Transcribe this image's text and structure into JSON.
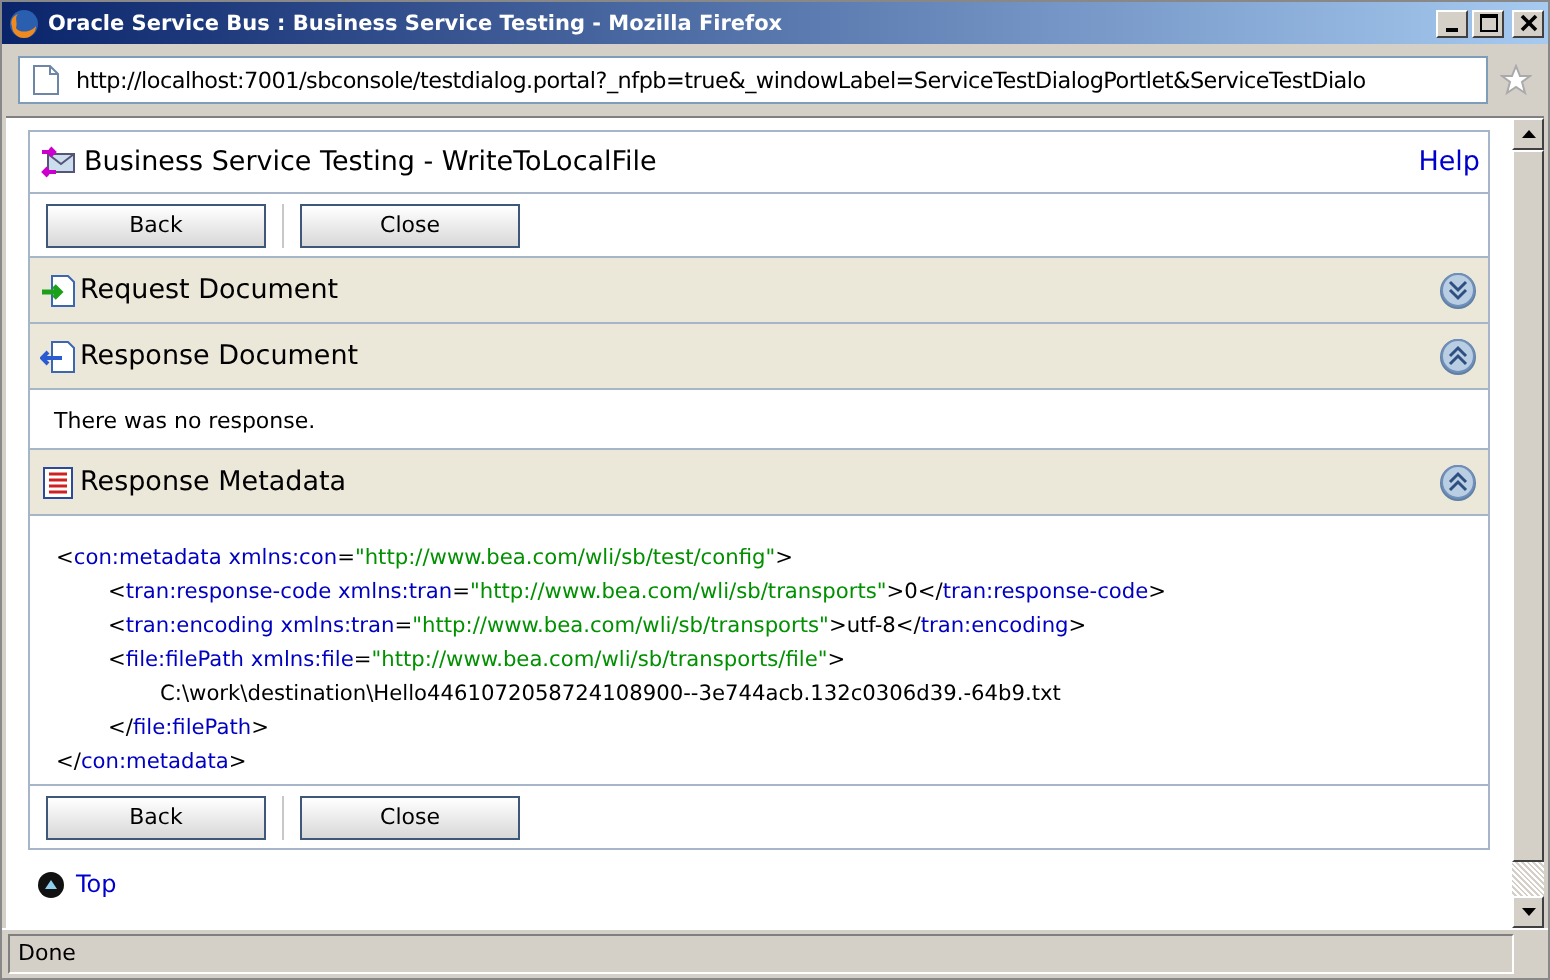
{
  "window": {
    "title": "Oracle Service Bus : Business Service Testing - Mozilla Firefox"
  },
  "address_bar": {
    "value": "http://localhost:7001/sbconsole/testdialog.portal?_nfpb=true&_windowLabel=ServiceTestDialogPortlet&ServiceTestDialo"
  },
  "page": {
    "title": "Business Service Testing - WriteToLocalFile",
    "help": "Help",
    "top_buttons": [
      "Back",
      "Close"
    ],
    "sections": [
      {
        "title": "Request Document",
        "kind": "request",
        "expanded": false
      },
      {
        "title": "Response Document",
        "kind": "response",
        "expanded": true,
        "message": "There was no response."
      },
      {
        "title": "Response Metadata",
        "kind": "metadata",
        "expanded": true,
        "xml": [
          {
            "tokens": [
              {
                "kind": "punct",
                "t": "<"
              },
              {
                "kind": "tag",
                "t": "con:metadata"
              },
              {
                "kind": "attr",
                "t": " xmlns:con"
              },
              {
                "kind": "punct",
                "t": "="
              },
              {
                "kind": "value",
                "t": "\"http://www.bea.com/wli/sb/test/config\""
              },
              {
                "kind": "punct",
                "t": ">"
              }
            ],
            "children": [
              {
                "tokens": [
                  {
                    "kind": "punct",
                    "t": "<"
                  },
                  {
                    "kind": "tag",
                    "t": "tran:response-code"
                  },
                  {
                    "kind": "attr",
                    "t": " xmlns:tran"
                  },
                  {
                    "kind": "punct",
                    "t": "="
                  },
                  {
                    "kind": "value",
                    "t": "\"http://www.bea.com/wli/sb/transports\""
                  },
                  {
                    "kind": "punct",
                    "t": ">0</"
                  },
                  {
                    "kind": "tag",
                    "t": "tran:response-code"
                  },
                  {
                    "kind": "punct",
                    "t": ">"
                  }
                ]
              },
              {
                "tokens": [
                  {
                    "kind": "punct",
                    "t": "<"
                  },
                  {
                    "kind": "tag",
                    "t": "tran:encoding"
                  },
                  {
                    "kind": "attr",
                    "t": " xmlns:tran"
                  },
                  {
                    "kind": "punct",
                    "t": "="
                  },
                  {
                    "kind": "value",
                    "t": "\"http://www.bea.com/wli/sb/transports\""
                  },
                  {
                    "kind": "punct",
                    "t": ">utf-8</"
                  },
                  {
                    "kind": "tag",
                    "t": "tran:encoding"
                  },
                  {
                    "kind": "punct",
                    "t": ">"
                  }
                ]
              },
              {
                "tokens": [
                  {
                    "kind": "punct",
                    "t": "<"
                  },
                  {
                    "kind": "tag",
                    "t": "file:filePath"
                  },
                  {
                    "kind": "attr",
                    "t": " xmlns:file"
                  },
                  {
                    "kind": "punct",
                    "t": "="
                  },
                  {
                    "kind": "value",
                    "t": "\"http://www.bea.com/wli/sb/transports/file\""
                  },
                  {
                    "kind": "punct",
                    "t": ">"
                  }
                ],
                "children": [
                  {
                    "tokens": [
                      {
                        "t": "C:\\work\\destination\\Hello4461072058724108900--3e744acb.132c0306d39.-64b9.txt"
                      }
                    ]
                  }
                ]
              },
              {
                "tokens": [
                  {
                    "kind": "punct",
                    "t": "</"
                  },
                  {
                    "kind": "tag",
                    "t": "file:filePath"
                  },
                  {
                    "kind": "punct",
                    "t": ">"
                  }
                ]
              }
            ]
          },
          {
            "tokens": [
              {
                "kind": "punct",
                "t": "</"
              },
              {
                "kind": "tag",
                "t": "con:metadata"
              },
              {
                "kind": "punct",
                "t": ">"
              }
            ]
          }
        ]
      }
    ],
    "bottom_buttons": [
      "Back",
      "Close"
    ],
    "top_link": "Top"
  },
  "status_bar": {
    "text": "Done"
  }
}
